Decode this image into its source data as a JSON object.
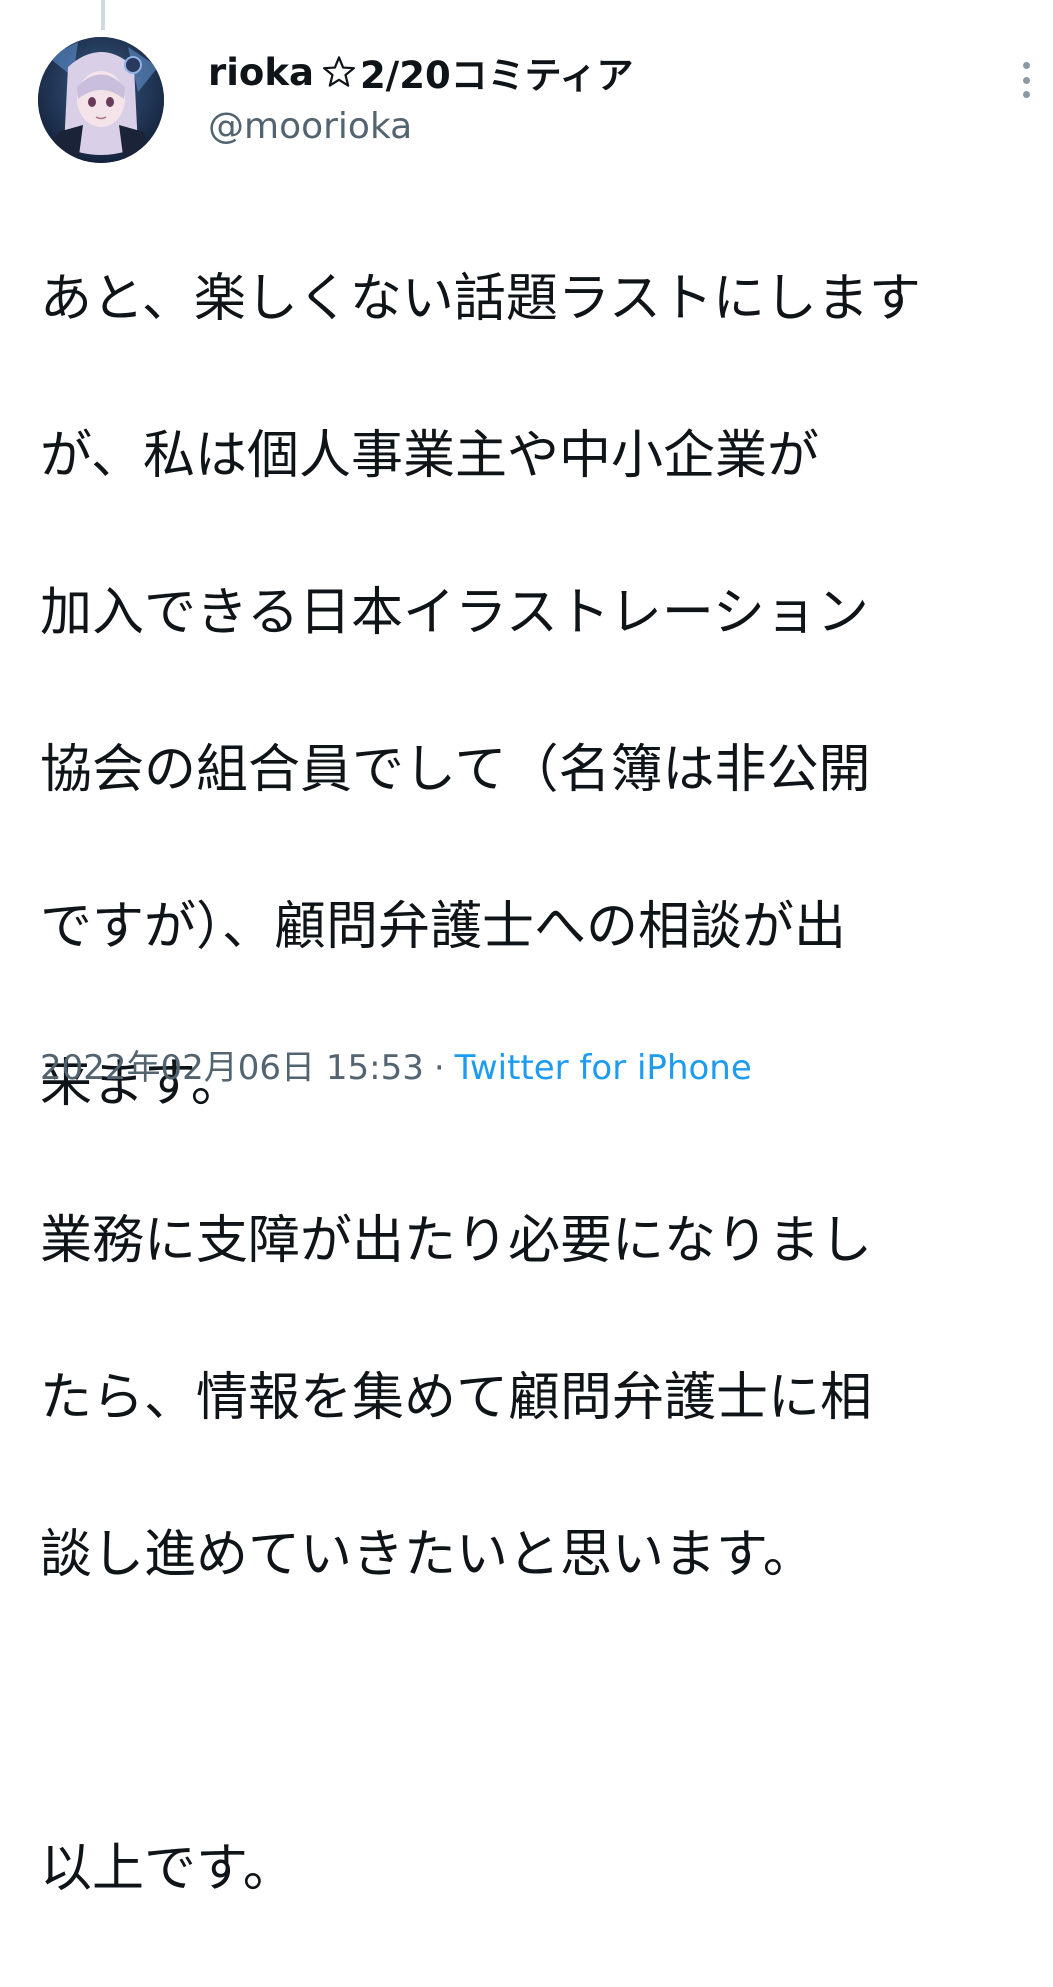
{
  "tweet": {
    "author": {
      "display_name": "rioka",
      "name_suffix": "2/20コミティア",
      "name_icon": "star-outline-icon",
      "handle": "@moorioka",
      "avatar_icon": "anime-avatar-illustration"
    },
    "menu_icon": "more-vertical-icon",
    "body_lines": [
      "あと、楽しくない話題ラストにします",
      "が、私は個人事業主や中小企業が",
      "加入できる日本イラストレーション",
      "協会の組合員でして（名簿は非公開",
      "ですが）、顧問弁護士への相談が出",
      "来ます。",
      "業務に支障が出たり必要になりまし",
      "たら、情報を集めて顧問弁護士に相",
      "談し進めていきたいと思います。",
      "",
      "以上です。"
    ],
    "timestamp": "2022年02月06日 15:53",
    "separator": "·",
    "source": "Twitter for iPhone"
  },
  "colors": {
    "text": "#0f1419",
    "secondary": "#536471",
    "link": "#1d9bf0",
    "thread_line": "#cfd9de"
  }
}
